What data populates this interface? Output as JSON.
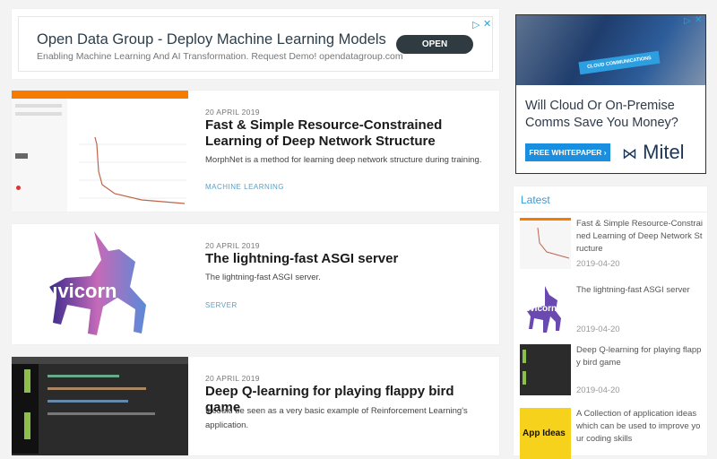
{
  "top_ad": {
    "title": "Open Data Group - Deploy Machine Learning Models",
    "subtitle": "Enabling Machine Learning And AI Transformation. Request Demo! opendatagroup.com",
    "button": "OPEN"
  },
  "posts": [
    {
      "date": "20 APRIL 2019",
      "title": "Fast & Simple Resource-Constrained Learning of Deep Network Structure",
      "desc": "MorphNet is a method for learning deep network structure during training.",
      "tag": "MACHINE LEARNING"
    },
    {
      "date": "20 APRIL 2019",
      "title": "The lightning-fast ASGI server",
      "desc": "The lightning-fast ASGI server.",
      "tag": "SERVER",
      "logo_text": "uvicorn"
    },
    {
      "date": "20 APRIL 2019",
      "title": "Deep Q-learning for playing flappy bird game",
      "desc": "It could be seen as a very basic example of Reinforcement Learning's application."
    }
  ],
  "side_ad": {
    "headline": "Will Cloud Or On-Premise Comms Save You Money?",
    "button": "FREE WHITEPAPER ›",
    "brand": "Mitel",
    "image_text": "CLOUD COMMUNICATIONS"
  },
  "latest": {
    "heading": "Latest",
    "items": [
      {
        "title": "Fast & Simple Resource-Constrained Learning of Deep Network Structure",
        "date": "2019-04-20"
      },
      {
        "title": "The lightning-fast ASGI server",
        "date": "2019-04-20",
        "logo_text": "uvicorn"
      },
      {
        "title": "Deep Q-learning for playing flappy bird game",
        "date": "2019-04-20"
      },
      {
        "title": "A Collection of application ideas which can be used to improve your coding skills",
        "thumb_text": "App Ideas"
      }
    ]
  },
  "colors": {
    "accent": "#3a9ad9",
    "tensorboard": "#f57c00",
    "app_ideas": "#f7d21c"
  }
}
